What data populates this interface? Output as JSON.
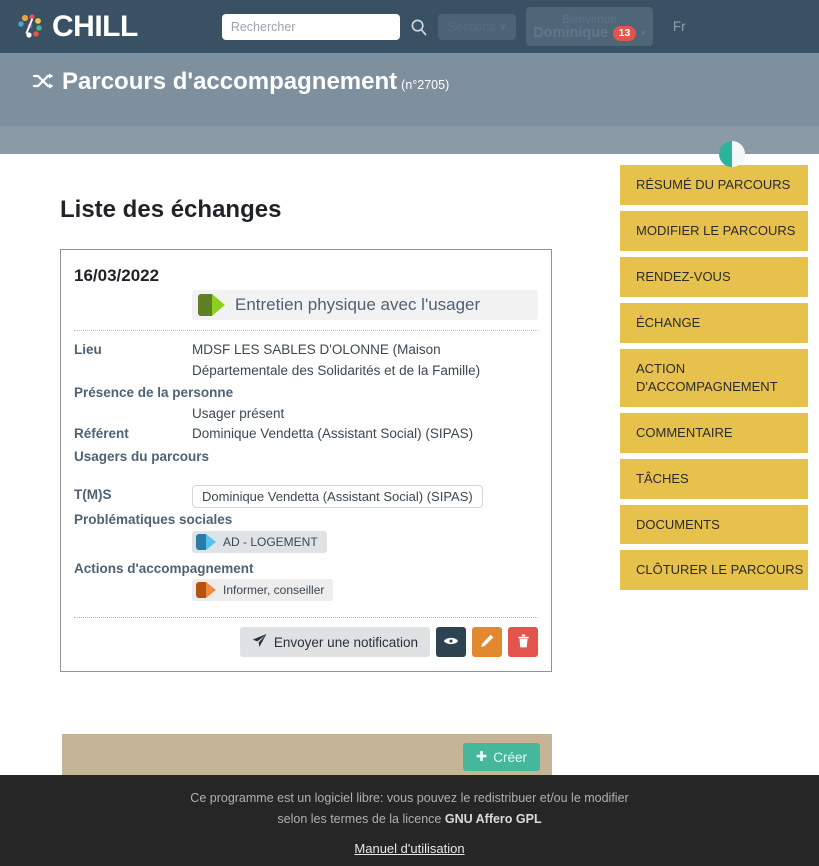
{
  "topnav": {
    "brand": "CHILL",
    "logo_icon": "chill-dots-logo",
    "search": {
      "placeholder": "Rechercher",
      "value": "",
      "icon": "search-icon"
    },
    "sections_label": "Sections",
    "user": {
      "welcome": "Bienvenue",
      "name": "Dominique",
      "badge": "13",
      "caret_icon": "chevron-down-icon"
    },
    "language": "Fr"
  },
  "banner": {
    "icon": "shuffle-icon",
    "title": "Parcours d'accompagnement",
    "number": "(n°2705)"
  },
  "main": {
    "page_title": "Liste des échanges",
    "card": {
      "date": "16/03/2022",
      "type_icon": "green-activity-tag-icon",
      "type_label": "Entretien physique avec l'usager",
      "fields": [
        {
          "label": "Lieu",
          "value": "MDSF LES SABLES D'OLONNE (Maison Départementale des Solidarités et de la Famille)"
        },
        {
          "label": "Présence de la personne",
          "value": "Usager présent"
        },
        {
          "label": "Référent",
          "value": "Dominique Vendetta (Assistant Social) (SIPAS)"
        },
        {
          "label": "Usagers du parcours",
          "value": ""
        }
      ],
      "tms": {
        "label": "T(M)S",
        "value": "Dominique Vendetta (Assistant Social) (SIPAS)"
      },
      "social_issues": {
        "label": "Problématiques sociales",
        "chip_icon": "blue-social-issue-tag-icon",
        "chip": "AD - LOGEMENT"
      },
      "accompaniment_actions": {
        "label": "Actions d'accompagnement",
        "chip_icon": "orange-action-tag-icon",
        "chip": "Informer, conseiller"
      },
      "actions": {
        "notify_label": "Envoyer une notification",
        "notify_icon": "paper-plane-icon",
        "view_icon": "eye-icon",
        "edit_icon": "pencil-icon",
        "delete_icon": "trash-icon"
      }
    },
    "create_label": "Créer",
    "create_icon": "plus-icon"
  },
  "sidebar": {
    "indicator_icon": "half-circle-progress-icon",
    "items": [
      {
        "label": "RÉSUMÉ DU PARCOURS"
      },
      {
        "label": "MODIFIER LE PARCOURS"
      },
      {
        "label": "RENDEZ-VOUS"
      },
      {
        "label": "ÉCHANGE"
      },
      {
        "label": "ACTION D'ACCOMPAGNEMENT"
      },
      {
        "label": "COMMENTAIRE"
      },
      {
        "label": "TÂCHES"
      },
      {
        "label": "DOCUMENTS"
      },
      {
        "label": "CLÔTURER LE PARCOURS"
      }
    ]
  },
  "footer": {
    "line1": "Ce programme est un logiciel libre: vous pouvez le redistribuer et/ou le modifier",
    "line2_prefix": "selon les termes de la licence ",
    "license": "GNU Affero GPL",
    "manual_link": "Manuel d'utilisation"
  },
  "colors": {
    "navbar": "#3a5163",
    "banner": "#7e8f9d",
    "sidebar_item": "#e6c14c",
    "accent_teal": "#44b79c",
    "badge_red": "#e2544c",
    "create_bar": "#c6b496",
    "footer": "#262626"
  }
}
